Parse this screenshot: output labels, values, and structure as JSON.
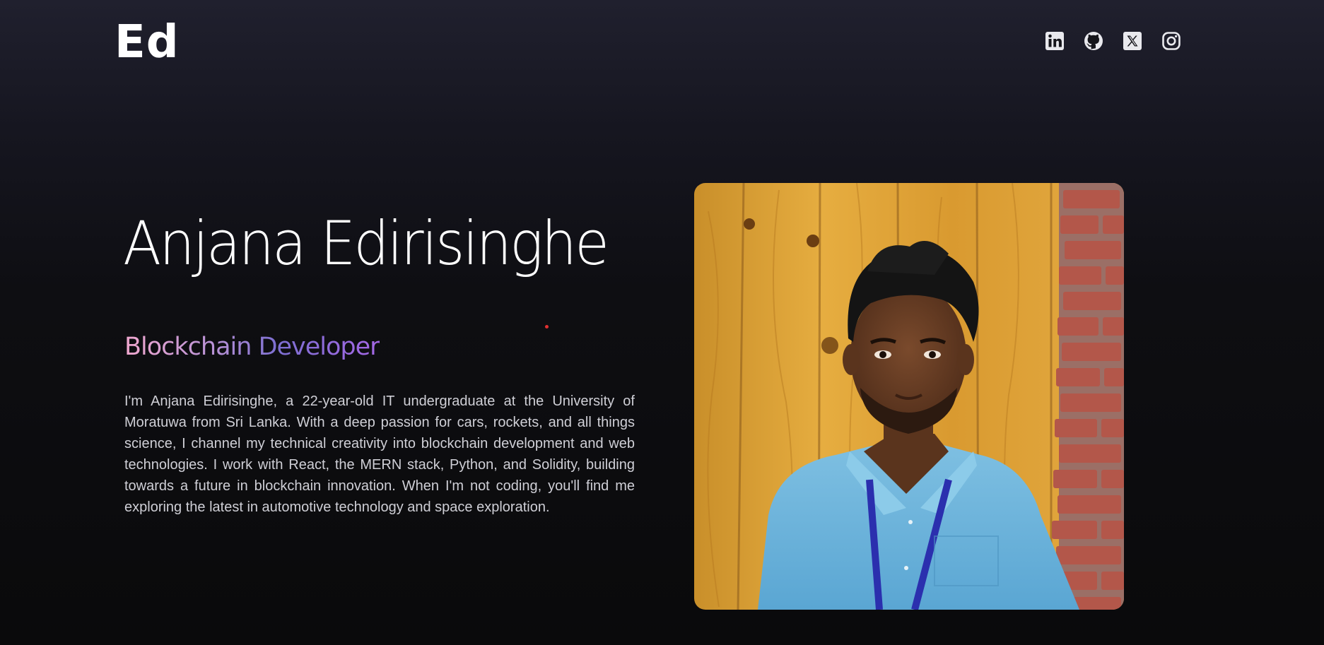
{
  "header": {
    "logo_text": "Ed",
    "social_links": [
      {
        "name": "linkedin-icon"
      },
      {
        "name": "github-icon"
      },
      {
        "name": "x-icon"
      },
      {
        "name": "instagram-icon"
      }
    ]
  },
  "hero": {
    "name": "Anjana Edirisinghe",
    "role": "Blockchain Developer",
    "bio": "I'm Anjana Edirisinghe, a 22-year-old IT undergraduate at the University of Moratuwa from Sri Lanka. With a deep passion for cars, rockets, and all things science, I channel my technical creativity into blockchain development and web technologies. I work with React, the MERN stack, Python, and Solidity, building towards a future in blockchain innovation. When I'm not coding, you'll find me exploring the latest in automotive technology and space exploration."
  },
  "colors": {
    "background_top": "#20202e",
    "background_bottom": "#0a0a0b",
    "role_gradient_start": "#f0a8cf",
    "role_gradient_end": "#a467e6",
    "accent_dot": "#e03030"
  }
}
